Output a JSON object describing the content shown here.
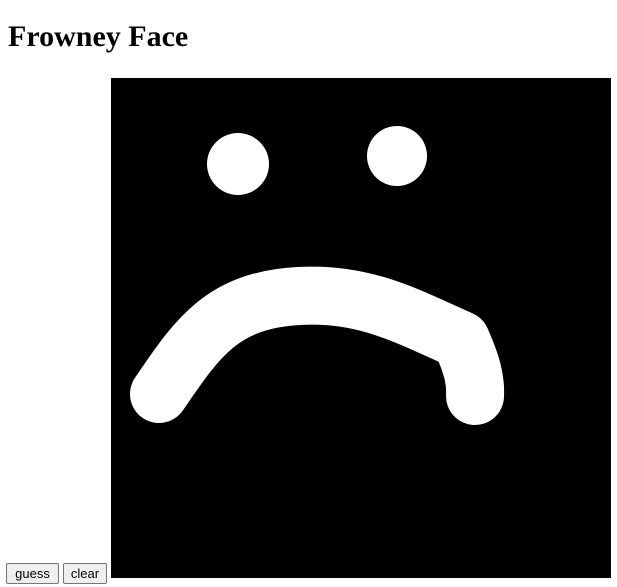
{
  "page": {
    "title": "Frowney Face"
  },
  "controls": {
    "guess_label": "guess",
    "clear_label": "clear"
  },
  "drawing_canvas": {
    "background_color": "#000000",
    "ink_color": "#ffffff",
    "content": [
      "left-eye",
      "right-eye",
      "frown-mouth"
    ]
  }
}
